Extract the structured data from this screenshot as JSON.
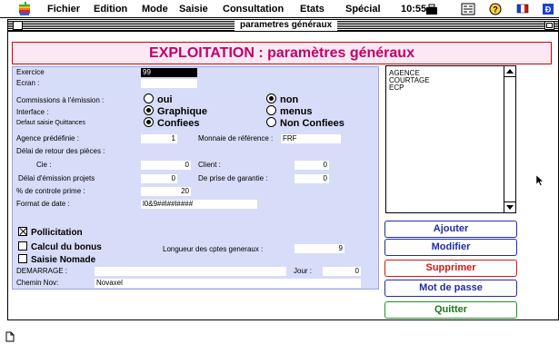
{
  "menubar": {
    "items": [
      "Fichier",
      "Edition",
      "Mode",
      "Saisie",
      "Consultation",
      "Etats",
      "Spécial"
    ],
    "clock": "10:55"
  },
  "window": {
    "title": "parametres généraux"
  },
  "header": {
    "title": "EXPLOITATION : paramètres généraux"
  },
  "form": {
    "exercice_label": "Exercice",
    "exercice_value": "99",
    "ecran_label": "Ecran :",
    "ecran_value": "",
    "commissions_label": "Commissions à l'émission :",
    "commissions_oui": "oui",
    "commissions_non": "non",
    "interface_label": "Interface :",
    "interface_graphique": "Graphique",
    "interface_menus": "menus",
    "defaut_label": "Defaut saisie Quittances",
    "defaut_confiees": "Confiees",
    "defaut_non_confiees": "Non Confiees",
    "agence_label": "Agence prédéfinie :",
    "agence_value": "1",
    "monnaie_label": "Monnaie de référence :",
    "monnaie_value": "FRF",
    "delai_retour_label": "Délai de retour des pièces :",
    "cie_label": "Cie :",
    "cie_value": "0",
    "client_label": "Client :",
    "client_value": "0",
    "delai_emission_label": "Délai d'émission projets",
    "delai_emission_value": "0",
    "prise_garantie_label": "De prise de garantie :",
    "prise_garantie_value": "0",
    "controle_label": "% de controle prime :",
    "controle_value": "20",
    "format_date_label": "Format de date :",
    "format_date_value": "l0&9##l##l####",
    "pollicitation_label": "Pollicitation",
    "calcul_bonus_label": "Calcul du bonus",
    "saisie_nomade_label": "Saisie Nomade",
    "longueur_label": "Longueur des cptes generaux :",
    "longueur_value": "9",
    "demarrage_label": "DEMARRAGE :",
    "demarrage_value": "",
    "jour_label": "Jour :",
    "jour_value": "0",
    "chemin_label": "Chemin Nov:",
    "chemin_value": "Novaxel"
  },
  "list": {
    "items": [
      "AGENCE",
      "COURTAGE",
      "ECP"
    ]
  },
  "buttons": {
    "ajouter": "Ajouter",
    "modifier": "Modifier",
    "supprimer": "Supprimer",
    "mot_de_passe": "Mot de passe",
    "quitter": "Quitter"
  },
  "colors": {
    "header_text": "#c0006a",
    "panel_bg": "#d7dcf8",
    "button_blue": "#1e2ca8",
    "button_red": "#d01818",
    "button_green": "#1a9a1a"
  }
}
